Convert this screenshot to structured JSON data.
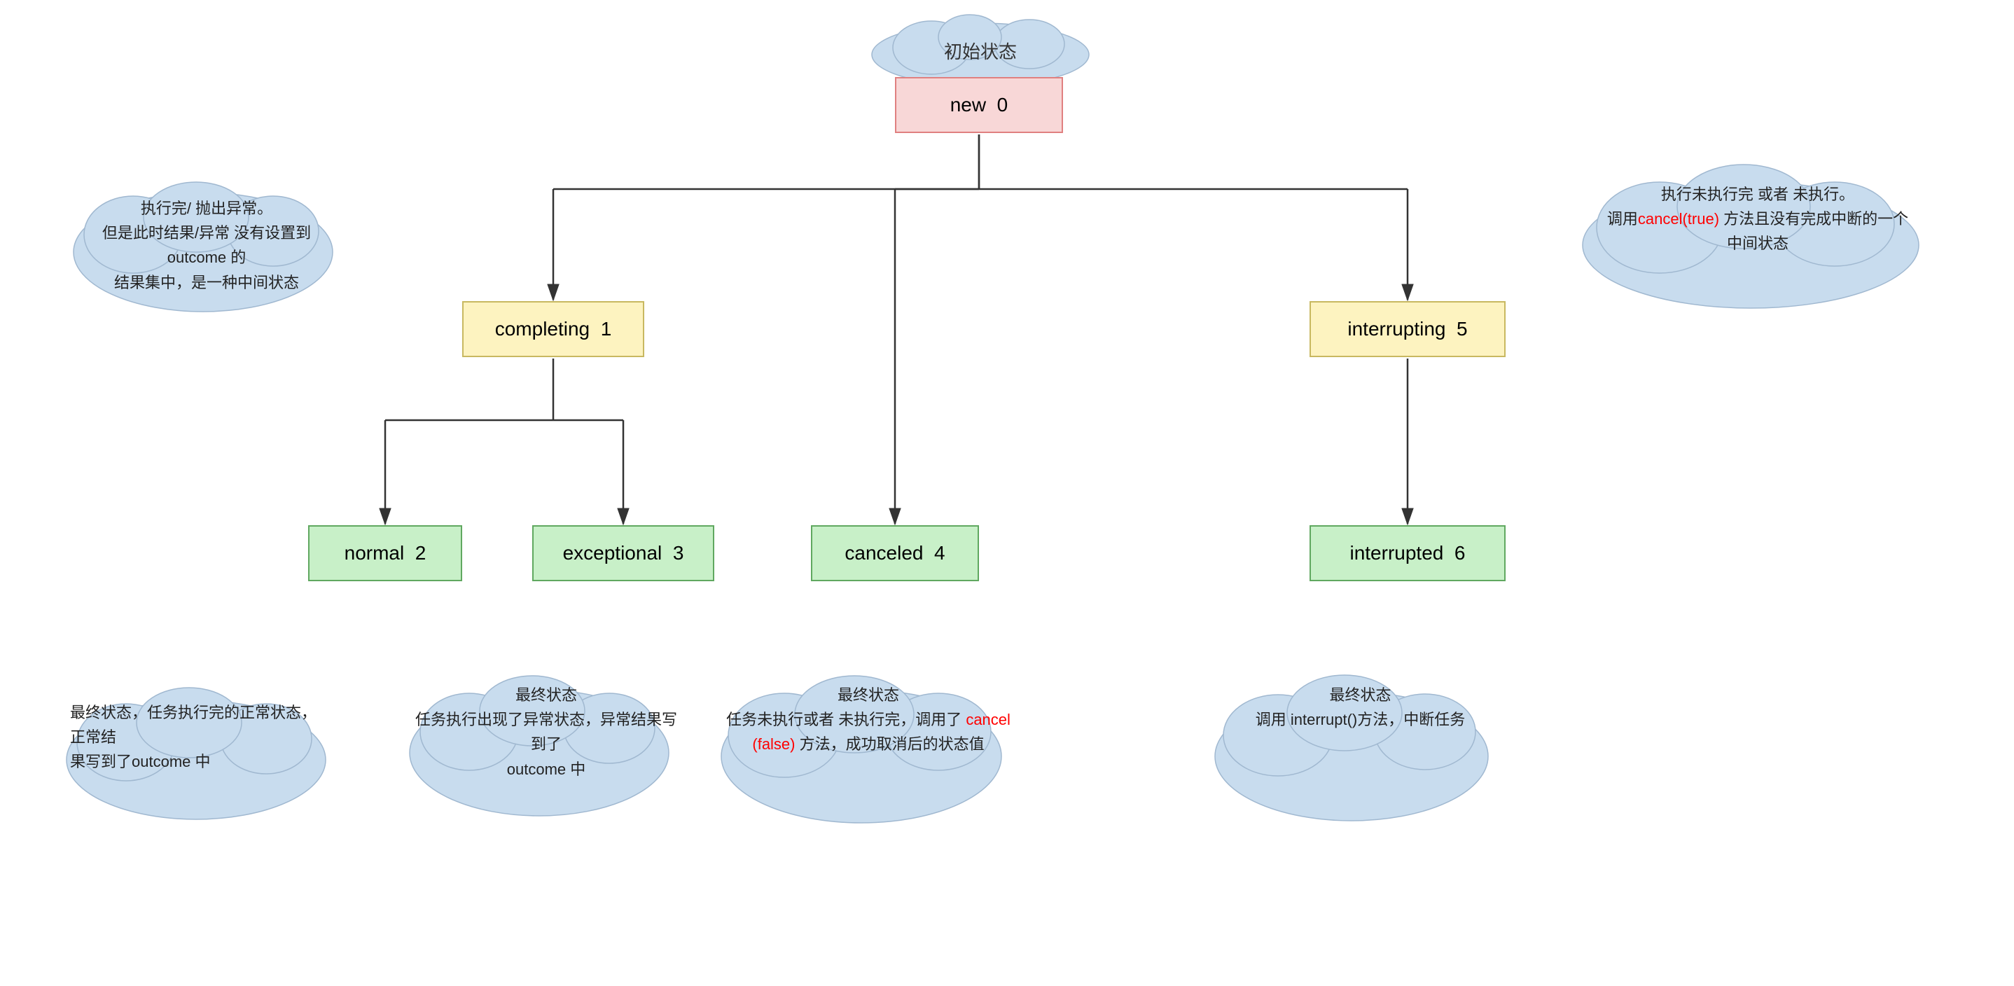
{
  "states": {
    "new": {
      "label": "new",
      "number": "0"
    },
    "completing": {
      "label": "completing",
      "number": "1"
    },
    "interrupting": {
      "label": "interrupting",
      "number": "5"
    },
    "normal": {
      "label": "normal",
      "number": "2"
    },
    "exceptional": {
      "label": "exceptional",
      "number": "3"
    },
    "canceled": {
      "label": "canceled",
      "number": "4"
    },
    "interrupted": {
      "label": "interrupted",
      "number": "6"
    }
  },
  "clouds": {
    "initial": "初始状态",
    "completing_desc": "执行完/ 抛出异常。\n但是此时结果/异常 没有设置到 outcome 的\n结果集中，是一种中间状态",
    "interrupting_desc": "执行未执行完 或者 未执行。\n调用 cancel(true) 方法且没有完成中断的一个\n中间状态",
    "normal_desc": "最终状态，任务执行完的正常状态，正常结\n果写到了outcome 中",
    "exceptional_desc": "最终状态\n任务执行出现了异常状态，异常结果写到了\noutcome 中",
    "canceled_desc_part1": "最终状态\n任务未执行或者 未执行完，调用了 cancel",
    "canceled_desc_part2": "(false)",
    "canceled_desc_part3": " 方法，成功取消后的状态值",
    "interrupted_desc": "最终状态\n调用 interrupt()方法，中断任务"
  }
}
